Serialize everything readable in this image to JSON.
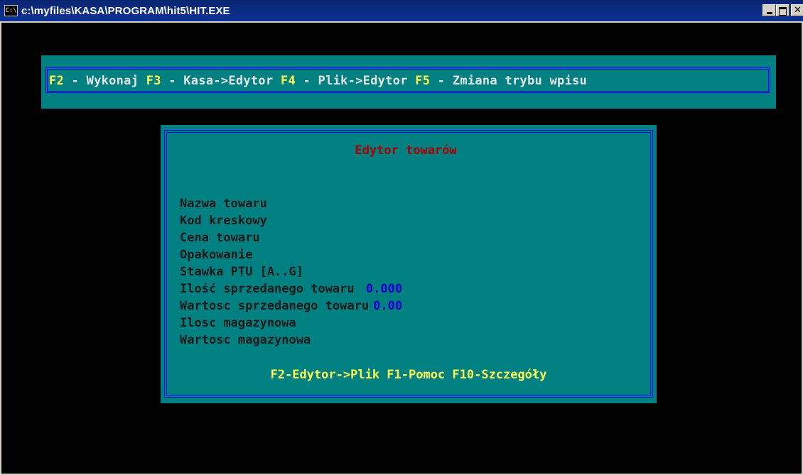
{
  "window": {
    "title": "c:\\myfiles\\KASA\\PROGRAM\\hit5\\HIT.EXE",
    "icon_label": "C:\\",
    "icon": "console-icon",
    "controls": [
      "minimize-icon",
      "maximize-icon",
      "close-icon"
    ]
  },
  "function_bar": {
    "items": [
      {
        "key": "F2",
        "label": " - Wykonaj "
      },
      {
        "key": "F3",
        "label": " - Kasa->Edytor "
      },
      {
        "key": "F4",
        "label": " - Plik->Edytor "
      },
      {
        "key": "F5",
        "label": " - Zmiana trybu wpisu"
      }
    ]
  },
  "dialog": {
    "title": "Edytor towarów",
    "fields": [
      {
        "label": "Nazwa towaru",
        "value": ""
      },
      {
        "label": "Kod kreskowy",
        "value": ""
      },
      {
        "label": "Cena towaru",
        "value": ""
      },
      {
        "label": "Opakowanie",
        "value": ""
      },
      {
        "label": "Stawka PTU [A..G]",
        "value": ""
      },
      {
        "label": "Ilość sprzedanego towaru ",
        "value": "0.000"
      },
      {
        "label": "Wartosc sprzedanego towaru",
        "value": "0.00"
      },
      {
        "label": "Ilosc magazynowa",
        "value": ""
      },
      {
        "label": "Wartosc magazynowa",
        "value": ""
      }
    ],
    "footer": "F2-Edytor->Plik F1-Pomoc F10-Szczegóły"
  },
  "colors": {
    "titlebar": "#0a2470",
    "console_bg": "#000000",
    "panel_bg": "#008080",
    "frame": "#0000ff",
    "key_highlight": "#ffff55",
    "dialog_title": "#aa0000",
    "value": "#0000cc"
  }
}
